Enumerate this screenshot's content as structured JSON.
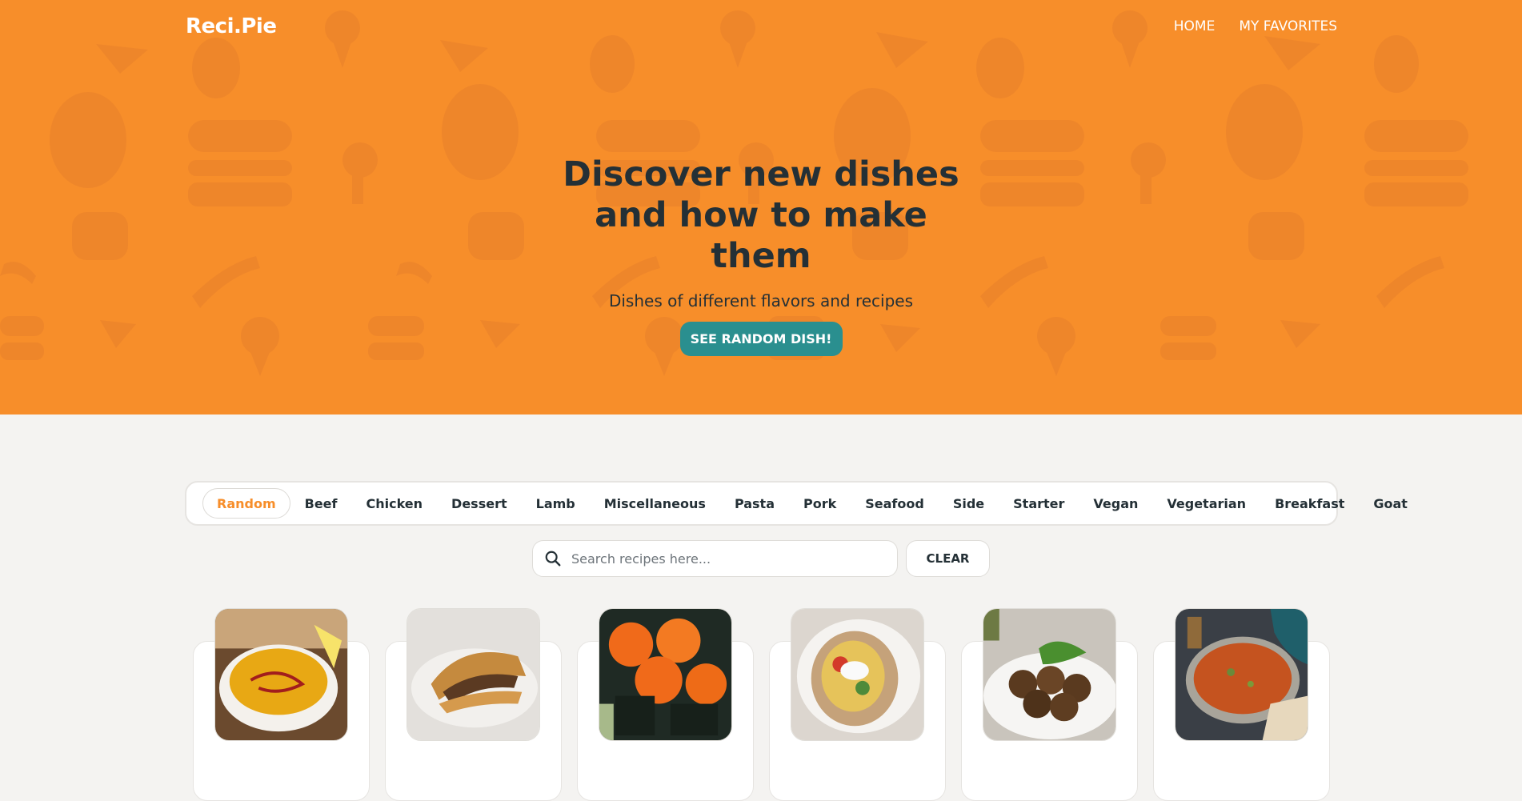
{
  "app": {
    "logo": "Reci.Pie"
  },
  "nav": {
    "home": "HOME",
    "favorites": "MY FAVORITES"
  },
  "hero": {
    "title": "Discover new dishes and how to make them",
    "subtitle": "Dishes of different flavors and recipes",
    "cta": "SEE RANDOM DISH!"
  },
  "categories": [
    "Random",
    "Beef",
    "Chicken",
    "Dessert",
    "Lamb",
    "Miscellaneous",
    "Pasta",
    "Pork",
    "Seafood",
    "Side",
    "Starter",
    "Vegan",
    "Vegetarian",
    "Breakfast",
    "Goat"
  ],
  "active_category": "Random",
  "search": {
    "placeholder": "Search recipes here...",
    "value": "",
    "clear": "CLEAR"
  },
  "recipes": [
    {
      "image": "lentil-soup"
    },
    {
      "image": "meat-pastry"
    },
    {
      "image": "sushi-rolls"
    },
    {
      "image": "stuffed-potato"
    },
    {
      "image": "falafel"
    },
    {
      "image": "curry-soup"
    }
  ],
  "colors": {
    "hero": "#f78e2a",
    "accent": "#f78e2a",
    "button": "#2a8f8f",
    "text": "#243036",
    "background": "#f4f3f1"
  }
}
